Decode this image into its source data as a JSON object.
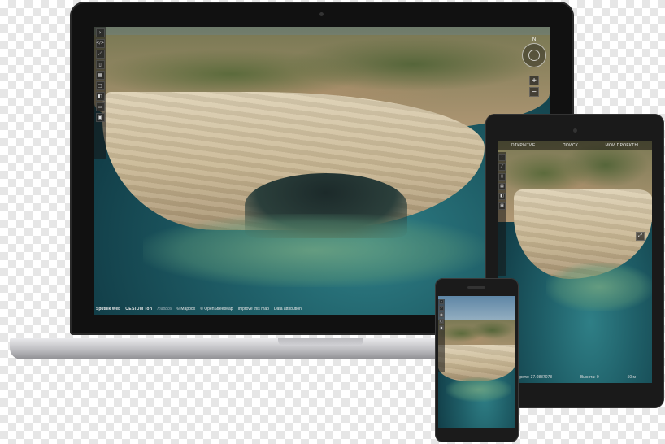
{
  "laptop": {
    "toolbar_icons": [
      "chevron-right-icon",
      "code-icon",
      "ruler-icon",
      "document-icon",
      "grid-icon",
      "square-icon",
      "layers-icon",
      "window-icon",
      "image-icon"
    ],
    "compass_label": "N",
    "zoom_in": "+",
    "zoom_out": "−",
    "credits": {
      "brand": "Sputnik Web",
      "cesium": "CESIUM",
      "cesium_suffix": "ion",
      "mapbox": "mapbox",
      "links": [
        "© Mapbox",
        "© OpenStreetMap",
        "Improve this map"
      ],
      "attribution": "Data attribution"
    }
  },
  "tablet": {
    "topbar_left": "ОТКРЫТИЕ",
    "topbar_mid": "ПОИСК",
    "topbar_right": "МОИ ПРОЕКТЫ",
    "status_left": "Широта: 37.0887078",
    "status_mid": "Высота: 0",
    "status_right": "50 м"
  },
  "colors": {
    "sea": "#1f5f68",
    "cliff": "#d9c9a8",
    "device_body": "#111111"
  }
}
